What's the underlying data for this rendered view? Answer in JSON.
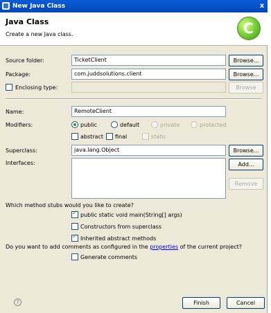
{
  "window": {
    "title": "New Java Class",
    "close_glyph": "x",
    "icon": "java-class-wizard-icon"
  },
  "header": {
    "title": "Java Class",
    "description": "Create a new Java class.",
    "logo_letter": "C",
    "logo_icon": "class-logo-icon"
  },
  "form": {
    "source_folder": {
      "label": "Source folder:",
      "value": "TicketClient",
      "button": "Browse..."
    },
    "package": {
      "label": "Package:",
      "value": "com.juddsolutions.client",
      "button": "Browse..."
    },
    "enclosing_type": {
      "label": "Enclosing type:",
      "value": "",
      "checked": false,
      "button": "Browse"
    },
    "name": {
      "label": "Name:",
      "value": "RemoteClient"
    },
    "modifiers": {
      "label": "Modifiers:",
      "public": "public",
      "default": "default",
      "private": "private",
      "protected": "protected",
      "selected": "public",
      "abstract": "abstract",
      "final": "final",
      "static": "static"
    },
    "superclass": {
      "label": "Superclass:",
      "value": "java.lang.Object",
      "button": "Browse..."
    },
    "interfaces": {
      "label": "Interfaces:",
      "add_button": "Add...",
      "remove_button": "Remove"
    }
  },
  "stubs": {
    "question": "Which method stubs would you like to create?",
    "main_method": {
      "label": "public static void main(String[] args)",
      "checked": true
    },
    "constructors": {
      "label": "Constructors from superclass",
      "checked": false
    },
    "inherited": {
      "label": "Inherited abstract methods",
      "checked": true
    }
  },
  "comments": {
    "question_before": "Do you want to add comments as configured in the ",
    "link": "properties",
    "question_after": " of the current project?",
    "generate": {
      "label": "Generate comments",
      "checked": false
    }
  },
  "footer": {
    "help_glyph": "?",
    "finish_button": "Finish",
    "cancel_button": "Cancel"
  },
  "colors": {
    "title_bar": "#0a5cd6",
    "dialog_bg": "#ece9d8",
    "check_mark": "#21a121",
    "link": "#0000ee"
  }
}
